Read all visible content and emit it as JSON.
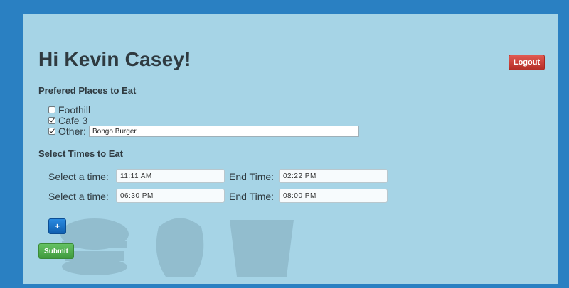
{
  "header": {
    "greeting": "Hi Kevin Casey!",
    "logout_label": "Logout"
  },
  "places": {
    "heading": "Prefered Places to Eat",
    "items": [
      {
        "label": "Foothill",
        "checked": false
      },
      {
        "label": "Cafe 3",
        "checked": true
      },
      {
        "label": "Other:",
        "checked": true,
        "value": "Bongo Burger"
      }
    ]
  },
  "times": {
    "heading": "Select Times to Eat",
    "start_label": "Select a time:",
    "end_label": "End Time:",
    "rows": [
      {
        "start": "11:11 AM",
        "end": "02:22 PM"
      },
      {
        "start": "06:30 PM",
        "end": "08:00 PM"
      }
    ]
  },
  "actions": {
    "add_label": "+",
    "submit_label": "Submit"
  },
  "colors": {
    "page_bg": "#2a80c2",
    "panel_bg": "#a6d4e6",
    "logout": "#c9372f",
    "add": "#1a72c8",
    "submit": "#4fae4d"
  }
}
